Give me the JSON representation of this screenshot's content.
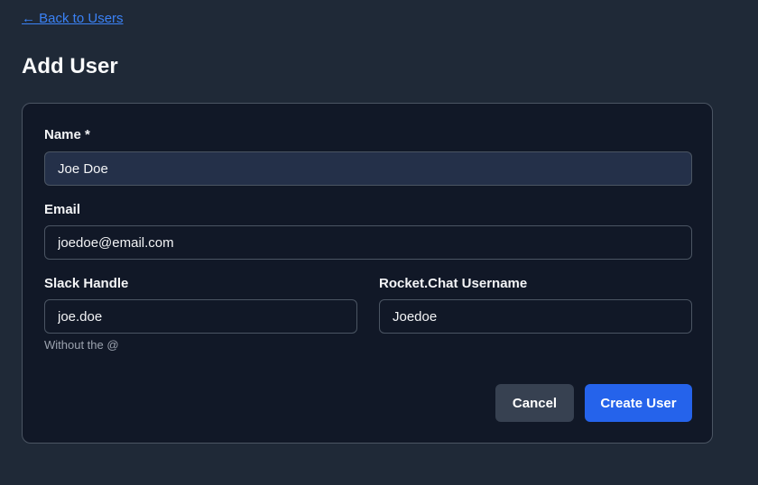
{
  "nav": {
    "back_label": "← Back to Users"
  },
  "page": {
    "title": "Add User"
  },
  "form": {
    "name": {
      "label": "Name *",
      "value": "Joe Doe"
    },
    "email": {
      "label": "Email",
      "value": "joedoe@email.com"
    },
    "slack": {
      "label": "Slack Handle",
      "value": "joe.doe",
      "hint": "Without the @"
    },
    "rocketchat": {
      "label": "Rocket.Chat Username",
      "value": "Joedoe"
    }
  },
  "actions": {
    "cancel_label": "Cancel",
    "create_label": "Create User"
  },
  "colors": {
    "background": "#1f2937",
    "card": "#111827",
    "accent": "#2563eb",
    "link": "#3b82f6"
  }
}
